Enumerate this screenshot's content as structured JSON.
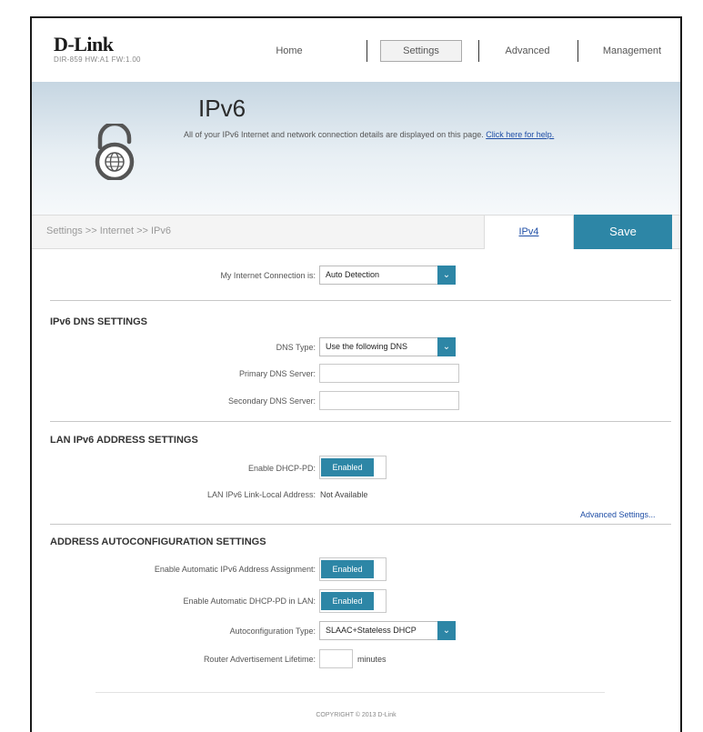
{
  "brand": {
    "name": "D-Link",
    "model": "DIR-859   HW:A1   FW:1.00"
  },
  "nav": {
    "home": "Home",
    "settings": "Settings",
    "advanced": "Advanced",
    "management": "Management"
  },
  "header": {
    "title": "IPv6",
    "description": "All of your IPv6 Internet and network connection details are displayed on this page.",
    "help_link": "Click here for help."
  },
  "breadcrumb": "Settings >> Internet >> IPv6",
  "actions": {
    "ipv4_tab": "IPv4",
    "save": "Save"
  },
  "connection": {
    "label": "My Internet Connection is:",
    "value": "Auto Detection"
  },
  "dns": {
    "title": "IPv6 DNS SETTINGS",
    "type_label": "DNS Type:",
    "type_value": "Use the following DNS",
    "primary_label": "Primary DNS Server:",
    "primary_value": "",
    "secondary_label": "Secondary DNS Server:",
    "secondary_value": ""
  },
  "lan": {
    "title": "LAN IPv6 ADDRESS SETTINGS",
    "dhcp_pd_label": "Enable DHCP-PD:",
    "dhcp_pd_state": "Enabled",
    "link_local_label": "LAN IPv6 Link-Local Address:",
    "link_local_value": "Not Available",
    "advanced_link": "Advanced Settings..."
  },
  "autoconf": {
    "title": "ADDRESS AUTOCONFIGURATION SETTINGS",
    "auto_assign_label": "Enable Automatic IPv6 Address Assignment:",
    "auto_assign_state": "Enabled",
    "auto_dhcp_pd_label": "Enable Automatic DHCP-PD in LAN:",
    "auto_dhcp_pd_state": "Enabled",
    "type_label": "Autoconfiguration Type:",
    "type_value": "SLAAC+Stateless DHCP",
    "lifetime_label": "Router Advertisement Lifetime:",
    "lifetime_value": "",
    "lifetime_unit": "minutes"
  },
  "footer": {
    "copyright": "COPYRIGHT © 2013 D-Link"
  },
  "colors": {
    "accent": "#2d86a6",
    "link": "#1f4ea6",
    "banner_top": "#c6d6e2"
  },
  "icons": {
    "lock": "lock-globe-icon",
    "dropdown": "chevron-down-icon"
  }
}
